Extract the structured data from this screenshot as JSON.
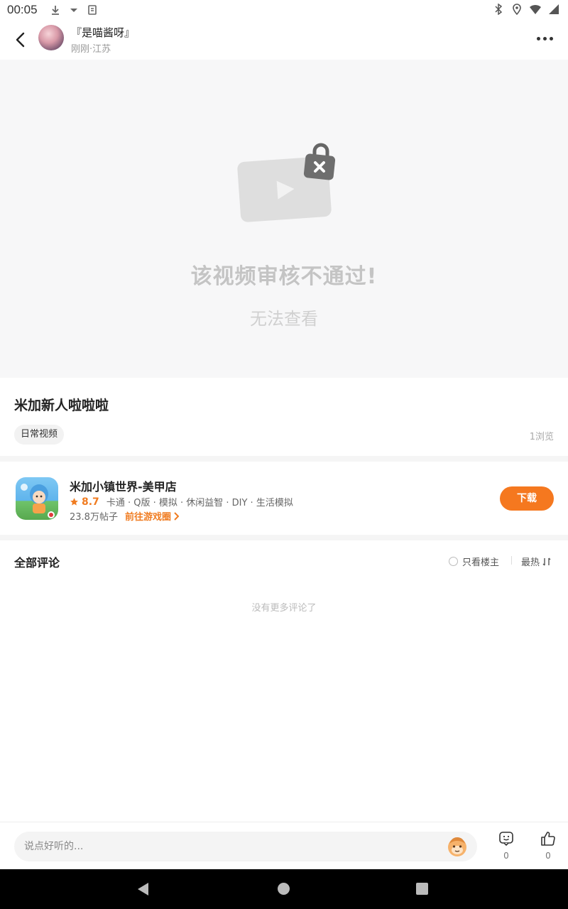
{
  "status_bar": {
    "time": "00:05"
  },
  "header": {
    "author_name": "『是喵酱呀』",
    "author_meta": "刚刚·江苏"
  },
  "video": {
    "message": "该视频审核不通过!",
    "sub_message": "无法查看"
  },
  "post": {
    "title": "米加新人啦啦啦",
    "tag": "日常视频",
    "views": "1浏览"
  },
  "game": {
    "name": "米加小镇世界-美甲店",
    "score": "8.7",
    "tags": "卡通 · Q版 · 模拟 · 休闲益智 · DIY · 生活模拟",
    "posts": "23.8万帖子",
    "link_label": "前往游戏圈",
    "download_label": "下载"
  },
  "comments": {
    "title": "全部评论",
    "only_op_label": "只看楼主",
    "sort_label": "最热",
    "empty_text": "没有更多评论了"
  },
  "bottom_bar": {
    "input_placeholder": "说点好听的...",
    "comment_count": "0",
    "like_count": "0"
  },
  "colors": {
    "accent": "#f5781f",
    "score": "#f07c21",
    "video_bg": "#f7f7f8"
  },
  "icons": [
    "download-icon",
    "dropdown-icon",
    "clipboard-icon",
    "bluetooth-icon",
    "location-icon",
    "wifi-icon",
    "battery-icon",
    "back-arrow-icon",
    "more-dots-icon",
    "video-locked-icon",
    "star-icon",
    "chevron-right-icon",
    "sort-icon",
    "emoji-icon",
    "comment-icon",
    "like-icon"
  ]
}
